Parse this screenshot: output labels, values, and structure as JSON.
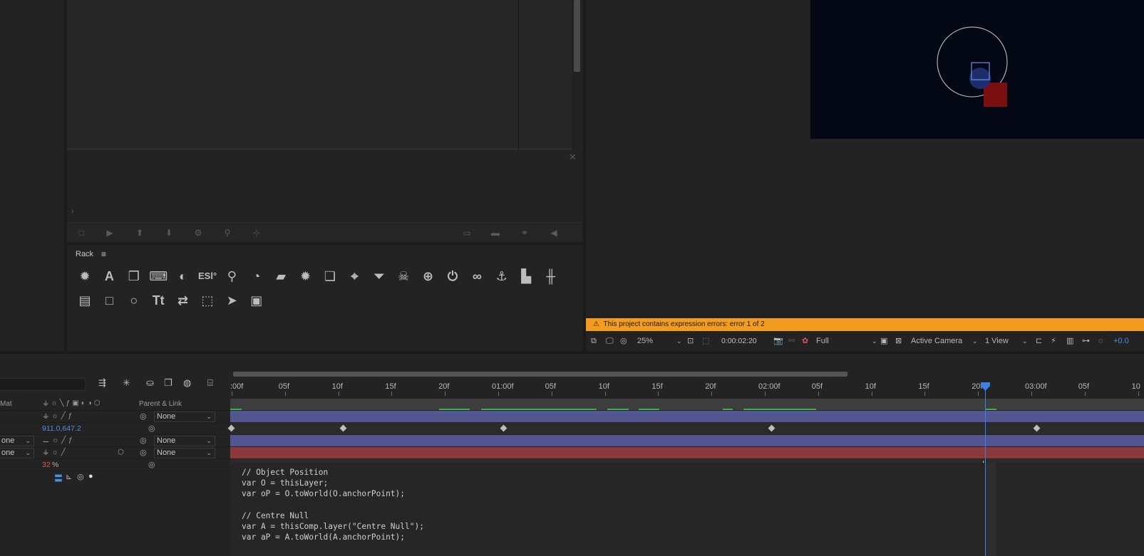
{
  "rack": {
    "title": "Rack",
    "icons_row1": [
      "bug-icon",
      "text-A-icon",
      "copy-icon",
      "keyboard-icon",
      "contrast-icon",
      "esl-icon",
      "pin-icon",
      "cookie-icon",
      "note-icon",
      "bug2-icon",
      "paste-icon",
      "map-marker-icon",
      "filter-icon",
      "skull-icon",
      "crosshair-icon",
      "power-icon",
      "link-icon",
      "anchor-icon",
      "swatch-icon",
      "align-icon"
    ],
    "icons_row2": [
      "document-icon",
      "square-icon",
      "circle-icon",
      "text-size-icon",
      "swap-icon",
      "shape-icon",
      "cursor-icon",
      "image-file-icon"
    ],
    "rack_glyphs_row1": [
      "✹",
      "A",
      "❐",
      "⌨",
      "◐",
      "ESl°",
      "⚲",
      "◔",
      "▰",
      "✹",
      "❏",
      "⌖",
      "⏷",
      "☠",
      "⊕",
      "⏻",
      "∞",
      "⚓",
      "▙",
      "╫"
    ],
    "rack_glyphs_row2": [
      "▤",
      "□",
      "○",
      "Tt",
      "⇄",
      "⬚",
      "➤",
      "▣"
    ]
  },
  "viewer": {
    "error_message": "This project contains expression errors: error 1 of 2",
    "zoom": "25%",
    "timecode": "0:00:02:20",
    "resolution": "Full",
    "camera": "Active Camera",
    "views": "1 View",
    "exposure": "+0.0",
    "colors": {
      "error_bar": "#f39c1d",
      "canvas": "#030814",
      "solid": "#7a0f12"
    }
  },
  "timeline": {
    "col_headers": {
      "mat": "Mat",
      "parent": "Parent & Link"
    },
    "rows": [
      {
        "parent": "None"
      },
      {
        "value": "911.0,647.2"
      },
      {
        "mode": "one",
        "parent": "None"
      },
      {
        "mode": "one",
        "parent": "None"
      },
      {
        "value": "32",
        "unit": "%"
      }
    ],
    "ruler_labels": [
      ":00f",
      "05f",
      "10f",
      "15f",
      "20f",
      "01:00f",
      "05f",
      "10f",
      "15f",
      "20f",
      "02:00f",
      "05f",
      "10f",
      "15f",
      "20f",
      "03:00f",
      "05f",
      "10"
    ],
    "track_colors": {
      "layer1": "#52558f",
      "layer2": "#52558f",
      "layer3": "#8b3a3c"
    },
    "expression_lines": [
      "// Object Position",
      "var O = thisLayer;",
      "var oP = O.toWorld(O.anchorPoint);",
      "",
      "// Centre Null",
      "var A = thisComp.layer(\"Centre Null\");",
      "var aP = A.toWorld(A.anchorPoint);"
    ]
  }
}
